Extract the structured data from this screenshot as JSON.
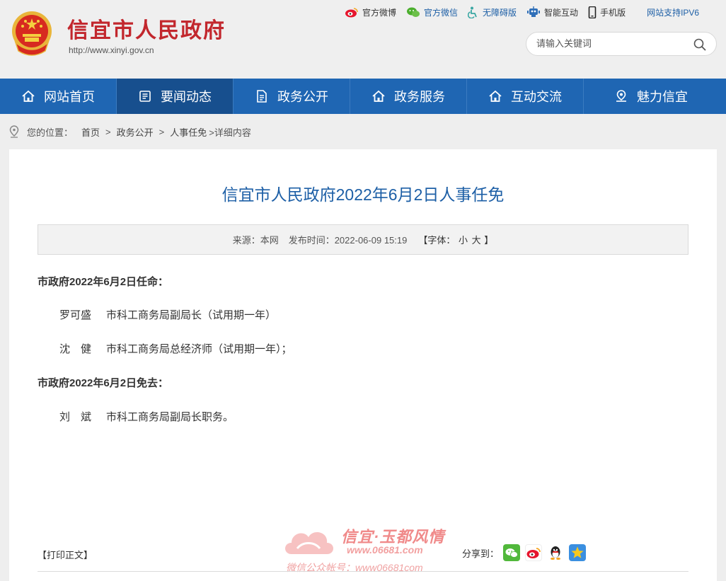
{
  "header": {
    "site_title": "信宜市人民政府",
    "site_url": "http://www.xinyi.gov.cn",
    "toplinks": [
      "官方微博",
      "官方微信",
      "无障碍版",
      "智能互动",
      "手机版",
      "网站支持IPV6"
    ],
    "search_placeholder": "请输入关键词"
  },
  "nav": {
    "items": [
      "网站首页",
      "要闻动态",
      "政务公开",
      "政务服务",
      "互动交流",
      "魅力信宜"
    ],
    "active": "要闻动态"
  },
  "breadcrumb": {
    "label": "您的位置：",
    "items": [
      "首页",
      "政务公开",
      "人事任免"
    ],
    "tail": ">详细内容"
  },
  "article": {
    "title": "信宜市人民政府2022年6月2日人事任免",
    "meta": {
      "source": "来源：本网",
      "published": "发布时间：2022-06-09 15:19",
      "font_label": "【字体：",
      "font_small": "小",
      "font_large": "大",
      "font_close": "】"
    },
    "sections": [
      {
        "heading": "市政府2022年6月2日任命："
      },
      {
        "heading": "市政府2022年6月2日免去："
      }
    ],
    "rows": [
      {
        "name": "罗可盛",
        "text": "市科工商务局副局长（试用期一年）"
      },
      {
        "name": "沈　健",
        "text": "市科工商务局总经济师（试用期一年）；"
      },
      {
        "name": "刘　斌",
        "text": "市科工商务局副局长职务。"
      }
    ],
    "print_label": "【打印正文】",
    "share_label": "分享到："
  },
  "watermark": {
    "brand": "信宜·玉都风情",
    "url": "www.06681.com",
    "wechat": "微信公众帐号：www06681com"
  },
  "colors": {
    "title_red": "#c2272d",
    "nav_blue": "#1f66b3",
    "nav_active": "#174f8e",
    "link_blue": "#1d5fa6"
  }
}
